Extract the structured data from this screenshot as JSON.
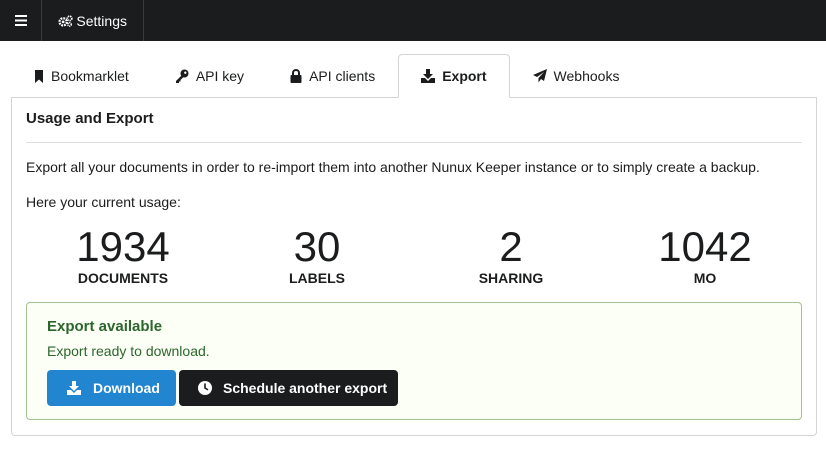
{
  "topbar": {
    "settings_label": "Settings",
    "icons": {
      "menu": "hamburger-icon",
      "settings": "cogs-icon"
    }
  },
  "tabs": [
    {
      "label": "Bookmarklet",
      "icon": "bookmark-icon",
      "active": false
    },
    {
      "label": "API key",
      "icon": "key-icon",
      "active": false
    },
    {
      "label": "API clients",
      "icon": "lock-icon",
      "active": false
    },
    {
      "label": "Export",
      "icon": "download-icon",
      "active": true
    },
    {
      "label": "Webhooks",
      "icon": "paper-plane-icon",
      "active": false
    }
  ],
  "panel": {
    "title": "Usage and Export",
    "description": "Export all your documents in order to re-import them into another Nunux Keeper instance or to simply create a backup.",
    "usage_intro": "Here your current usage:"
  },
  "stats": [
    {
      "value": "1934",
      "label": "DOCUMENTS"
    },
    {
      "value": "30",
      "label": "LABELS"
    },
    {
      "value": "2",
      "label": "SHARING"
    },
    {
      "value": "1042",
      "label": "MO"
    }
  ],
  "export_message": {
    "title": "Export available",
    "text": "Export ready to download.",
    "download_label": "Download",
    "schedule_label": "Schedule another export"
  },
  "colors": {
    "topbar": "#1b1c1d",
    "primary": "#2185d0",
    "success_text": "#2c662d",
    "success_bg": "#fcfff5",
    "success_border": "#a3c293"
  }
}
